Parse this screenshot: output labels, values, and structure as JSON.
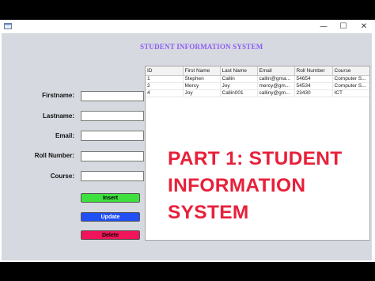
{
  "window": {
    "app_icon": "java-app-icon",
    "minimize_glyph": "—",
    "maximize_glyph": "☐",
    "close_glyph": "✕"
  },
  "heading": "STUDENT INFORMATION SYSTEM",
  "form": {
    "firstname_label": "Firstname:",
    "firstname_value": "",
    "lastname_label": "Lastname:",
    "lastname_value": "",
    "email_label": "Email:",
    "email_value": "",
    "roll_label": "Roll Number:",
    "roll_value": "",
    "course_label": "Course:",
    "course_value": ""
  },
  "buttons": {
    "insert": "Insert",
    "update": "Update",
    "delete": "Delete"
  },
  "colors": {
    "heading": "#8b5cf6",
    "insert": "#3ee03e",
    "update": "#1f4ff5",
    "delete": "#f0145a",
    "overlay": "#e8203a"
  },
  "table": {
    "columns": [
      "ID",
      "First Name",
      "Last Name",
      "Email",
      "Roll Number",
      "Course"
    ],
    "rows": [
      [
        "1",
        "Stephen",
        "Callin",
        "callin@gma...",
        "54654",
        "Computer S..."
      ],
      [
        "2",
        "Mercy",
        "Joy",
        "mercy@gm...",
        "54534",
        "Computer S..."
      ],
      [
        "4",
        "Joy",
        "Callin001",
        "calliny@gm...",
        "23430",
        "ICT"
      ]
    ]
  },
  "overlay": {
    "line1": "PART 1: STUDENT",
    "line2": "INFORMATION",
    "line3": "SYSTEM"
  }
}
